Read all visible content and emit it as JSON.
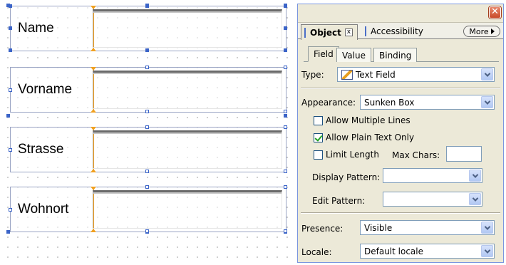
{
  "form": {
    "fields": [
      {
        "caption": "Name"
      },
      {
        "caption": "Vorname"
      },
      {
        "caption": "Strasse"
      },
      {
        "caption": "Wohnort"
      }
    ]
  },
  "palette": {
    "close_glyph": "✕",
    "tabs": {
      "object": "Object",
      "object_close": "x",
      "accessibility": "Accessibility",
      "more": "More"
    },
    "subtabs": {
      "field": "Field",
      "value": "Value",
      "binding": "Binding"
    },
    "type": {
      "label": "Type:",
      "value": "Text Field"
    },
    "appearance": {
      "label": "Appearance:",
      "value": "Sunken Box"
    },
    "allow_multiple_lines": {
      "label": "Allow Multiple Lines",
      "checked": false
    },
    "allow_plain_text_only": {
      "label": "Allow Plain Text Only",
      "checked": true
    },
    "limit_length": {
      "label": "Limit Length",
      "checked": false
    },
    "max_chars": {
      "label": "Max Chars:",
      "value": ""
    },
    "display_pattern": {
      "label": "Display Pattern:",
      "value": ""
    },
    "edit_pattern": {
      "label": "Edit Pattern:",
      "value": ""
    },
    "presence": {
      "label": "Presence:",
      "value": "Visible"
    },
    "locale": {
      "label": "Locale:",
      "value": "Default locale"
    }
  },
  "icons": {
    "type_icon": "text-field-icon",
    "dropdown": "chevron-down-icon",
    "more_arrow": "triangle-right-icon"
  },
  "colors": {
    "selection": "#3b64c8",
    "caption_split": "#f0a020",
    "palette_bg": "#ece9d8"
  }
}
